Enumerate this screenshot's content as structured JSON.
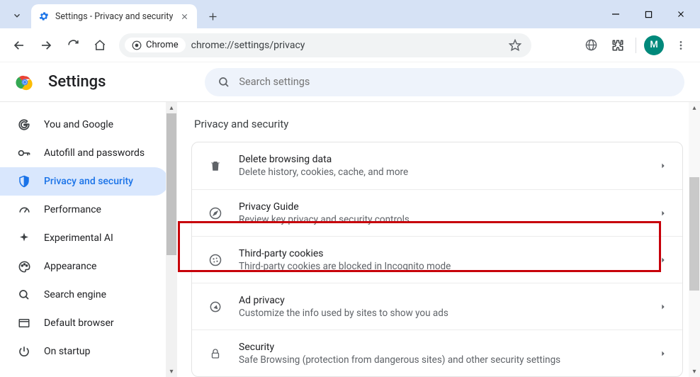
{
  "window": {
    "tab_title": "Settings - Privacy and security",
    "address_chip": "Chrome",
    "url": "chrome://settings/privacy",
    "avatar_letter": "M"
  },
  "header": {
    "title": "Settings",
    "search_placeholder": "Search settings"
  },
  "sidebar": {
    "items": [
      {
        "label": "You and Google"
      },
      {
        "label": "Autofill and passwords"
      },
      {
        "label": "Privacy and security"
      },
      {
        "label": "Performance"
      },
      {
        "label": "Experimental AI"
      },
      {
        "label": "Appearance"
      },
      {
        "label": "Search engine"
      },
      {
        "label": "Default browser"
      },
      {
        "label": "On startup"
      }
    ],
    "active_index": 2
  },
  "main": {
    "section_title": "Privacy and security",
    "rows": [
      {
        "title": "Delete browsing data",
        "sub": "Delete history, cookies, cache, and more"
      },
      {
        "title": "Privacy Guide",
        "sub": "Review key privacy and security controls"
      },
      {
        "title": "Third-party cookies",
        "sub": "Third-party cookies are blocked in Incognito mode"
      },
      {
        "title": "Ad privacy",
        "sub": "Customize the info used by sites to show you ads"
      },
      {
        "title": "Security",
        "sub": "Safe Browsing (protection from dangerous sites) and other security settings"
      }
    ],
    "highlighted_index": 2
  }
}
